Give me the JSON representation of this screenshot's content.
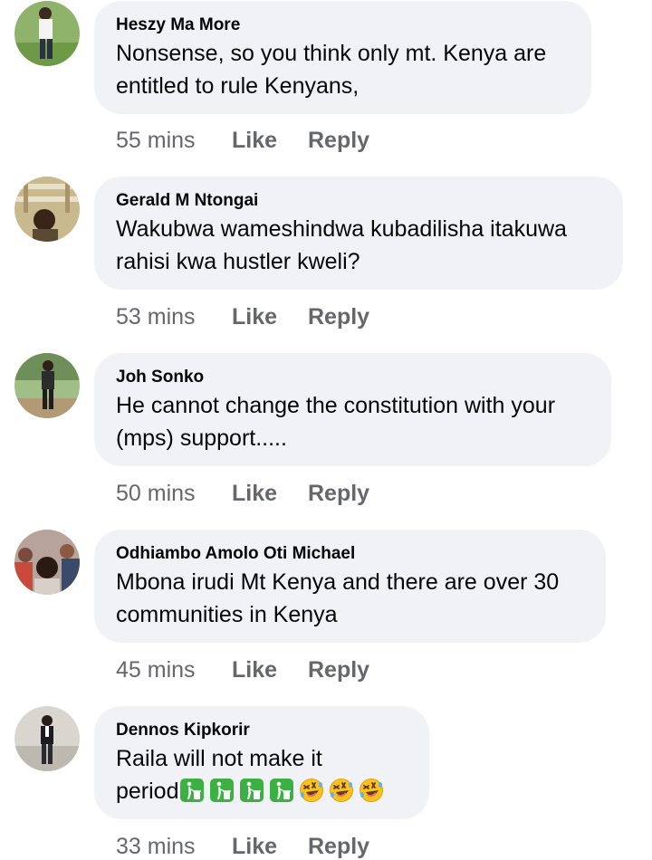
{
  "comments": [
    {
      "author": "Heszy Ma More",
      "lines": [
        "Nonsense, so you think only mt. Kenya are",
        "entitled to rule Kenyans,"
      ],
      "time": "55 mins",
      "like": "Like",
      "reply": "Reply"
    },
    {
      "author": "Gerald M Ntongai",
      "lines": [
        "Wakubwa wameshindwa kubadilisha itakuwa",
        "rahisi kwa hustler kweli?"
      ],
      "time": "53 mins",
      "like": "Like",
      "reply": "Reply"
    },
    {
      "author": "Joh Sonko",
      "lines": [
        "He cannot change the constitution with your",
        "(mps) support....."
      ],
      "time": "50 mins",
      "like": "Like",
      "reply": "Reply"
    },
    {
      "author": "Odhiambo Amolo Oti Michael",
      "lines": [
        "Mbona irudi Mt Kenya and there are over 30",
        "communities in Kenya"
      ],
      "time": "45 mins",
      "like": "Like",
      "reply": "Reply"
    },
    {
      "author": "Dennos Kipkorir",
      "lines": [
        "Raila will not make it",
        "period"
      ],
      "emojis": [
        "put-litter-in-bin-icon",
        "put-litter-in-bin-icon",
        "put-litter-in-bin-icon",
        "put-litter-in-bin-icon",
        "rolling-laughing-icon",
        "rolling-laughing-icon",
        "rolling-laughing-icon"
      ],
      "time": "33 mins",
      "like": "Like",
      "reply": "Reply"
    }
  ],
  "colors": {
    "bubble": "#f0f2f5",
    "text": "#050505",
    "meta": "#65676b"
  }
}
